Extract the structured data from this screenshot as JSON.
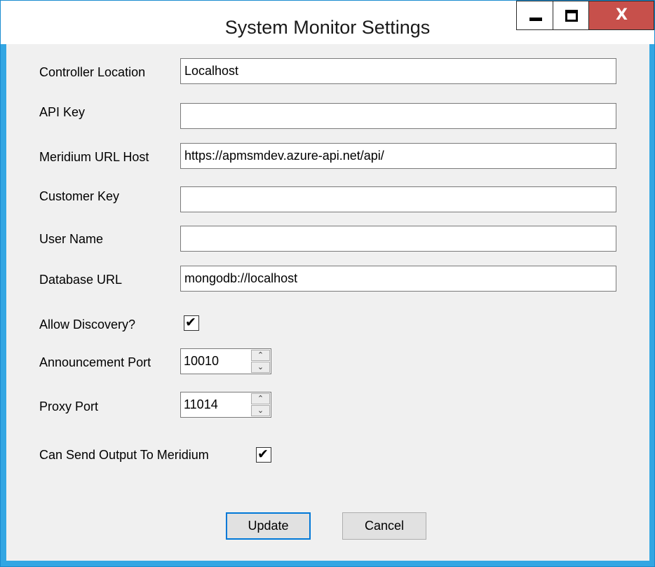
{
  "window": {
    "title": "System Monitor Settings"
  },
  "titlebar": {
    "close_glyph": "X"
  },
  "form": {
    "controller_location": {
      "label": "Controller Location",
      "value": "Localhost"
    },
    "api_key": {
      "label": "API Key",
      "value": ""
    },
    "meridium_url_host": {
      "label": "Meridium URL Host",
      "value": "https://apmsmdev.azure-api.net/api/"
    },
    "customer_key": {
      "label": "Customer Key",
      "value": ""
    },
    "user_name": {
      "label": "User Name",
      "value": ""
    },
    "database_url": {
      "label": "Database URL",
      "value": "mongodb://localhost"
    },
    "allow_discovery": {
      "label": "Allow Discovery?",
      "checked": true
    },
    "announcement_port": {
      "label": "Announcement Port",
      "value": "10010"
    },
    "proxy_port": {
      "label": "Proxy Port",
      "value": "11014"
    },
    "send_output": {
      "label": "Can Send Output To Meridium",
      "checked": true
    }
  },
  "buttons": {
    "update": "Update",
    "cancel": "Cancel"
  },
  "icons": {
    "minimize": "minimize-icon",
    "maximize": "maximize-icon",
    "close": "close-icon",
    "check": "checkmark-icon",
    "spin_up": "chevron-up-icon",
    "spin_down": "chevron-down-icon"
  },
  "colors": {
    "accent": "#33a6e3",
    "close": "#c7504b",
    "client_bg": "#f0f0f0"
  }
}
